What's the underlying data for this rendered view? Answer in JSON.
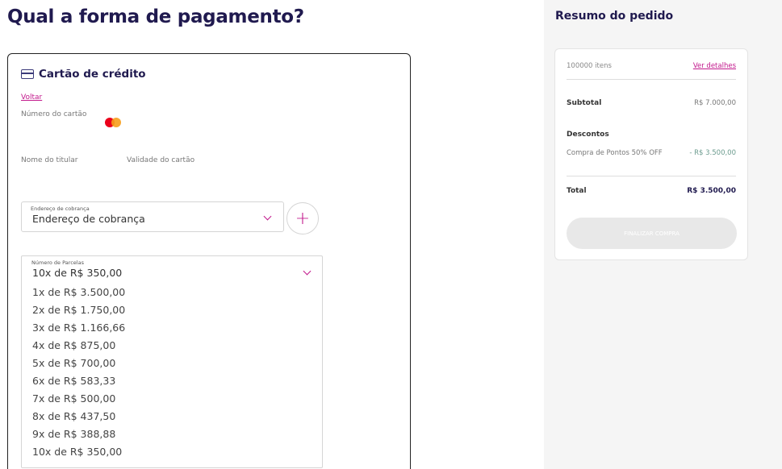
{
  "page": {
    "title": "Qual a forma de pagamento?"
  },
  "payment": {
    "method_title": "Cartão de crédito",
    "back_label": "Voltar",
    "card_number_label": "Número do cartão",
    "holder_label": "Nome do titular",
    "validity_label": "Validade do cartão",
    "address": {
      "small_label": "Endereço de cobrança",
      "value": "Endereço de cobrança"
    },
    "add_button_label": "+",
    "installments": {
      "small_label": "Número de Parcelas",
      "selected": "10x de R$ 350,00",
      "options": [
        "1x de R$ 3.500,00",
        "2x de R$ 1.750,00",
        "3x de R$ 1.166,66",
        "4x de R$ 875,00",
        "5x de R$ 700,00",
        "6x de R$ 583,33",
        "7x de R$ 500,00",
        "8x de R$ 437,50",
        "9x de R$ 388,88",
        "10x de R$ 350,00"
      ]
    }
  },
  "summary": {
    "title": "Resumo do pedido",
    "items_count": "100000 itens",
    "details_link": "Ver detalhes",
    "subtotal_label": "Subtotal",
    "subtotal_value": "R$ 7.000,00",
    "discounts_label": "Descontos",
    "discount_name": "Compra de Pontos 50% OFF",
    "discount_value": "- R$ 3.500,00",
    "total_label": "Total",
    "total_value": "R$ 3.500,00",
    "finish_button": "FINALIZAR COMPRA"
  },
  "colors": {
    "accent": "#c2188c",
    "title": "#201a4f",
    "sidebar_bg": "#f5f5f5"
  }
}
